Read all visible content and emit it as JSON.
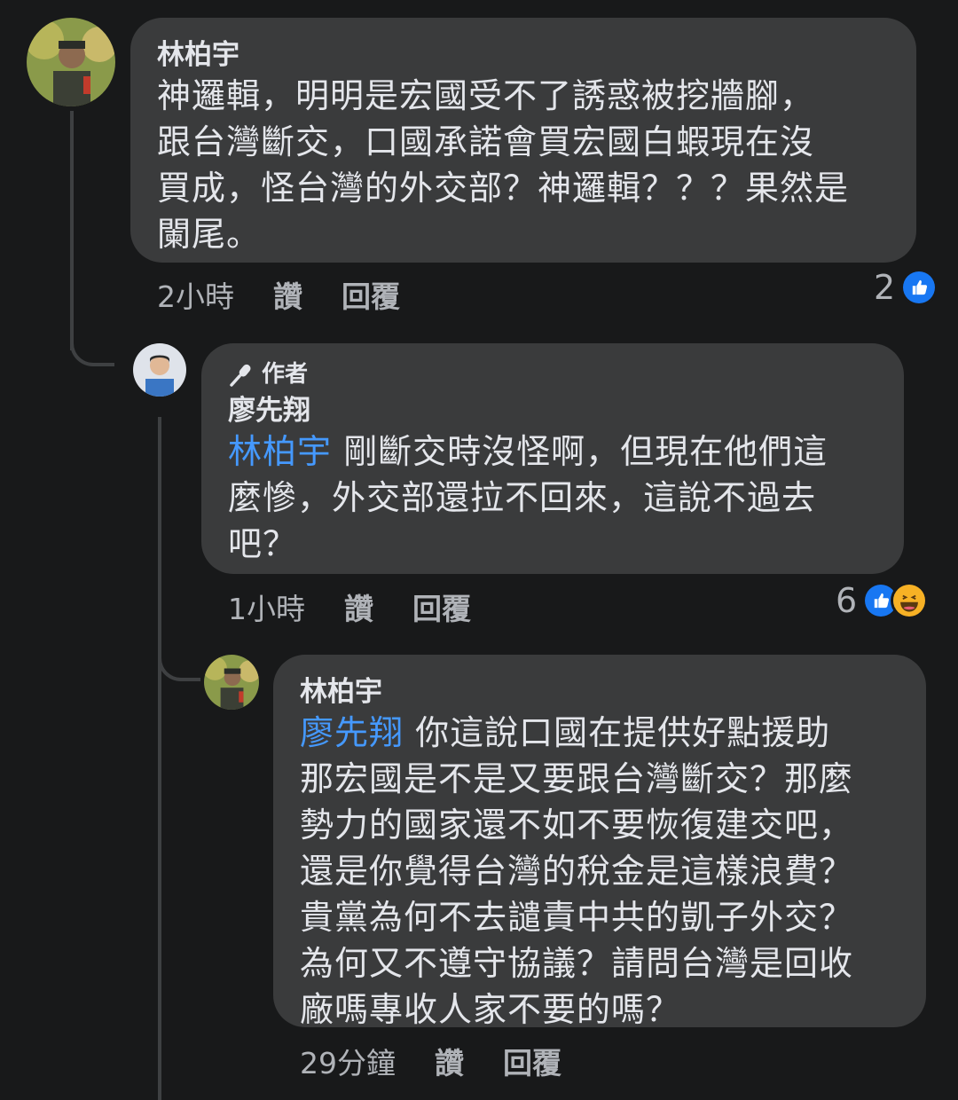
{
  "comments": [
    {
      "author": "林柏宇",
      "text_lines": [
        "神邏輯，明明是宏國受不了誘惑被挖牆腳，",
        "跟台灣斷交，口國承諾會買宏國白蝦現在沒",
        "買成，怪台灣的外交部？神邏輯？？？果然是",
        "闌尾。"
      ],
      "time": "2小時",
      "like_label": "讚",
      "reply_label": "回覆",
      "reaction_count": "2",
      "reactions": [
        "like-icon"
      ]
    },
    {
      "badge": "作者",
      "author": "廖先翔",
      "mention": "林柏宇",
      "text_lines": [
        " 剛斷交時沒怪啊，但現在他們這",
        "麼慘，外交部還拉不回來，這說不過去",
        "吧？"
      ],
      "time": "1小時",
      "like_label": "讚",
      "reply_label": "回覆",
      "reaction_count": "6",
      "reactions": [
        "like-icon",
        "laugh-icon"
      ]
    },
    {
      "author": "林柏宇",
      "mention": "廖先翔",
      "text_lines": [
        " 你這說口國在提供好點援助",
        "那宏國是不是又要跟台灣斷交？那麼",
        "勢力的國家還不如不要恢復建交吧，",
        "還是你覺得台灣的稅金是這樣浪費？",
        "貴黨為何不去譴責中共的凱子外交？",
        "為何又不遵守協議？請問台灣是回收",
        "廠嗎專收人家不要的嗎？"
      ],
      "time": "29分鐘",
      "like_label": "讚",
      "reply_label": "回覆"
    }
  ],
  "colors": {
    "background": "#18191a",
    "bubble": "#3a3b3c",
    "mention": "#4599ff",
    "like": "#1877f2",
    "laugh": "#f7b125"
  }
}
